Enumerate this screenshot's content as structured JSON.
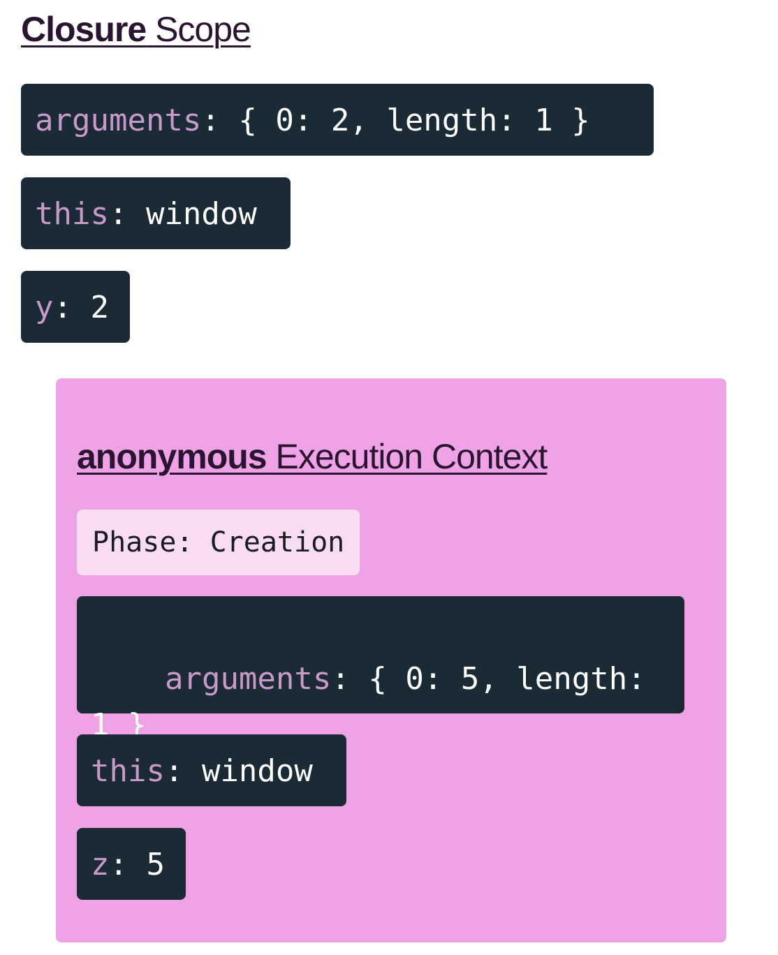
{
  "closure_scope": {
    "title_strong": "Closure",
    "title_light": " Scope",
    "vars": [
      {
        "key": "arguments",
        "value": ": { 0: 2, length: 1 }"
      },
      {
        "key": "this",
        "value": ": window"
      },
      {
        "key": "y",
        "value": ": 2"
      }
    ]
  },
  "execution_context": {
    "title_strong": "anonymous",
    "title_light": " Execution Context",
    "phase": "Phase: Creation",
    "vars": [
      {
        "key": "arguments",
        "value": ": { 0: 5, length: 1 }"
      },
      {
        "key": "this",
        "value": ": window"
      },
      {
        "key": "z",
        "value": ": 5"
      }
    ]
  },
  "colors": {
    "chip_bg": "#1b2b36",
    "key_color": "#c99ac9",
    "panel_bg": "#f0a2e6",
    "phase_bg": "#f7dcf4"
  }
}
